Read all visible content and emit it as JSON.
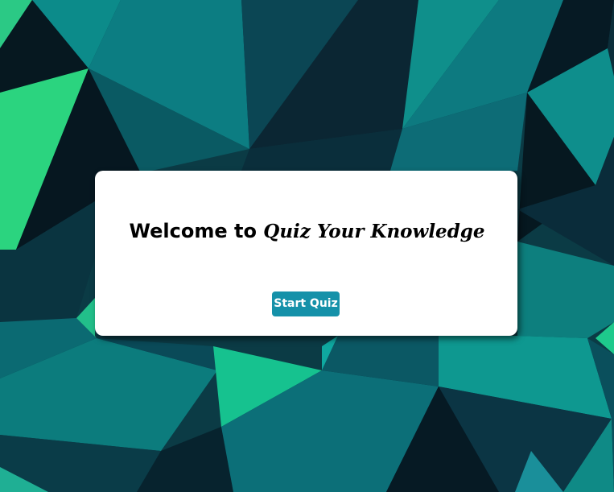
{
  "welcome": {
    "prefix": "Welcome to ",
    "brand": "Quiz Your Knowledge"
  },
  "start_button": {
    "label": "Start Quiz"
  },
  "colors": {
    "button": "#1591a9",
    "card": "#ffffff",
    "background_dark": "#0a1a24",
    "background_teal": "#0f8585",
    "background_green": "#2bd47f"
  }
}
